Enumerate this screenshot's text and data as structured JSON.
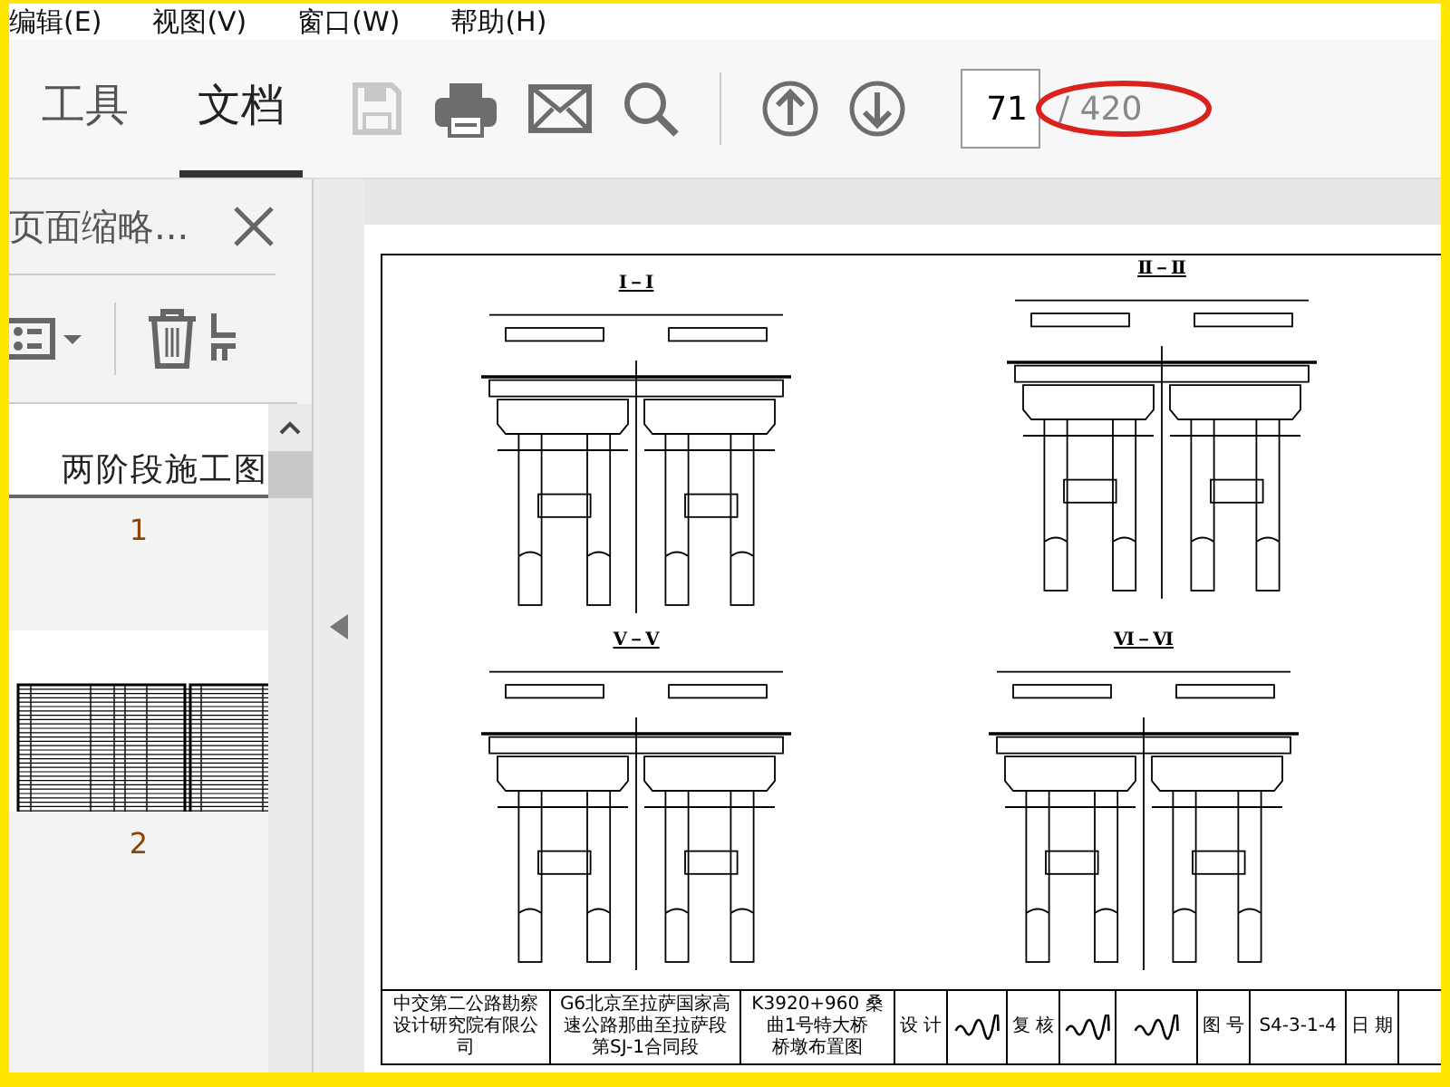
{
  "menu": [
    "编辑(E)",
    "视图(V)",
    "窗口(W)",
    "帮助(H)"
  ],
  "tabs": [
    {
      "label": "工具",
      "selected": false
    },
    {
      "label": "文档",
      "selected": true
    }
  ],
  "toolbar": [
    {
      "kind": "save",
      "disabled": true
    },
    {
      "kind": "print",
      "disabled": false
    },
    {
      "kind": "mail",
      "disabled": false
    },
    {
      "kind": "search",
      "disabled": false
    },
    {
      "kind": "divider"
    },
    {
      "kind": "up",
      "disabled": false
    },
    {
      "kind": "down",
      "disabled": false
    }
  ],
  "page_number": "71",
  "page_count": "/ 420",
  "annotation": {
    "kind": "ellipse"
  },
  "panel": {
    "title": "页面缩略...",
    "thumbnails": [
      {
        "label": "1",
        "caption": "两阶段施工图",
        "kind": "cover"
      },
      {
        "label": "2",
        "kind": "table"
      }
    ]
  },
  "document": {
    "sections": [
      "Ⅰ－Ⅰ",
      "Ⅱ－Ⅱ",
      "Ⅴ－Ⅴ",
      "Ⅵ－Ⅵ"
    ],
    "title_block": [
      {
        "kind": "text",
        "text": "中交第二公路勘察设计研究院有限公司"
      },
      {
        "kind": "lines",
        "lines": [
          "G6北京至拉萨国家高速公路那曲至拉萨段",
          "第SJ-1合同段"
        ]
      },
      {
        "kind": "lines",
        "lines": [
          "K3920+960 桑曲1号特大桥",
          "桥墩布置图"
        ]
      },
      {
        "kind": "text",
        "text": "设 计"
      },
      {
        "kind": "signature"
      },
      {
        "kind": "text",
        "text": "复 核"
      },
      {
        "kind": "signature"
      },
      {
        "kind": "signature"
      },
      {
        "kind": "text",
        "text": "图 号"
      },
      {
        "kind": "text",
        "text": "S4-3-1-4"
      },
      {
        "kind": "text",
        "text": "日 期"
      }
    ]
  }
}
